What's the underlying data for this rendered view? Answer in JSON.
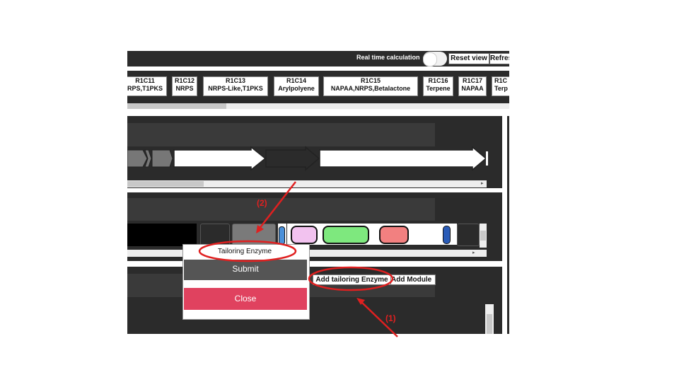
{
  "toolbar": {
    "realtime_label": "Real time calculation",
    "reset_label": "Reset view",
    "refresh_label": "Refres"
  },
  "regions": [
    {
      "id": "R1C11",
      "type": "RPS,T1PKS"
    },
    {
      "id": "R1C12",
      "type": "NRPS"
    },
    {
      "id": "R1C13",
      "type": "NRPS-Like,T1PKS"
    },
    {
      "id": "R1C14",
      "type": "Arylpolyene"
    },
    {
      "id": "R1C15",
      "type": "NAPAA,NRPS,Betalactone"
    },
    {
      "id": "R1C16",
      "type": "Terpene"
    },
    {
      "id": "R1C17",
      "type": "NAPAA"
    },
    {
      "id": "R1C",
      "type": "Terp"
    }
  ],
  "module_panel": {
    "add_tailoring_label": "Add tailoring Enzyme",
    "add_module_label": "Add Module"
  },
  "popup": {
    "input_value": "Tailoring Enzyme",
    "submit_label": "Submit",
    "close_label": "Close"
  },
  "annotations": {
    "step1": "(1)",
    "step2": "(2)"
  },
  "colors": {
    "dark_panel": "#2b2b2b",
    "submit_gray": "#555555",
    "close_red": "#e0425f",
    "annotation_red": "#e02020",
    "domain_pink": "#f2c2ef",
    "domain_green": "#7ee87e",
    "domain_salmon": "#f28080",
    "domain_blue": "#2a5cb8"
  }
}
